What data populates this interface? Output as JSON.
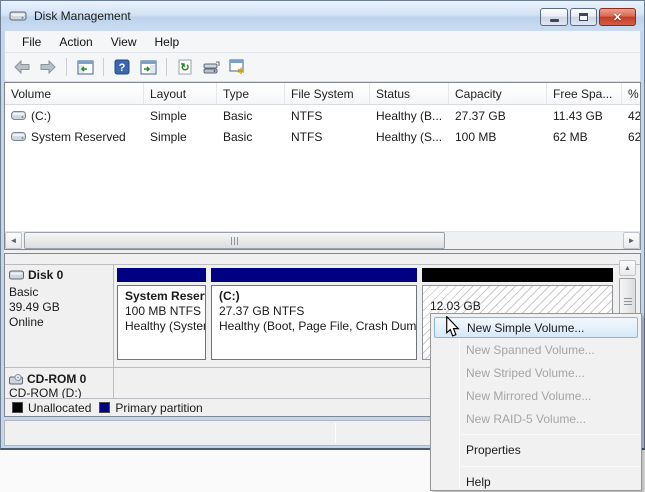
{
  "window": {
    "title": "Disk Management",
    "controls": {
      "minimize": "minimize",
      "maximize": "maximize",
      "close": "close"
    }
  },
  "menubar": {
    "items": {
      "file": "File",
      "action": "Action",
      "view": "View",
      "help": "Help"
    }
  },
  "toolbar": {
    "icons": [
      "back",
      "forward",
      "show-console-tree",
      "help",
      "show-action-pane",
      "refresh",
      "disk-list",
      "manage-wizard"
    ]
  },
  "volume_table": {
    "columns": {
      "volume": "Volume",
      "layout": "Layout",
      "type": "Type",
      "file_system": "File System",
      "status": "Status",
      "capacity": "Capacity",
      "free_space": "Free Spa...",
      "pct_free": "% F"
    },
    "rows": [
      {
        "volume": "(C:)",
        "layout": "Simple",
        "type": "Basic",
        "file_system": "NTFS",
        "status": "Healthy (B...",
        "capacity": "27.37 GB",
        "free_space": "11.43 GB",
        "pct_free": "42"
      },
      {
        "volume": "System Reserved",
        "layout": "Simple",
        "type": "Basic",
        "file_system": "NTFS",
        "status": "Healthy (S...",
        "capacity": "100 MB",
        "free_space": "62 MB",
        "pct_free": "62"
      }
    ]
  },
  "disk0": {
    "name": "Disk 0",
    "type": "Basic",
    "size": "39.49 GB",
    "status": "Online",
    "partitions": [
      {
        "name": "System Reserved",
        "size_fs": "100 MB NTFS",
        "status": "Healthy (System, Active, Primary Partition)",
        "kind": "primary"
      },
      {
        "name": "(C:)",
        "size_fs": "27.37 GB NTFS",
        "status": "Healthy (Boot, Page File, Crash Dump, Primary Partition)",
        "kind": "primary"
      },
      {
        "size": "12.03 GB",
        "label": "Unallocated",
        "kind": "unallocated"
      }
    ]
  },
  "cdrom": {
    "name": "CD-ROM 0",
    "drive": "CD-ROM (D:)"
  },
  "legend": {
    "unallocated": "Unallocated",
    "primary": "Primary partition"
  },
  "context_menu": {
    "items": {
      "new_simple": "New Simple Volume...",
      "new_spanned": "New Spanned Volume...",
      "new_striped": "New Striped Volume...",
      "new_mirrored": "New Mirrored Volume...",
      "new_raid5": "New RAID-5 Volume...",
      "properties": "Properties",
      "help": "Help"
    }
  },
  "colors": {
    "primary_partition": "#000082",
    "unallocated": "#000000",
    "menu_highlight_border": "#8eb4dc",
    "titlebar": "#cfe0f3",
    "close_button": "#c33c26"
  }
}
